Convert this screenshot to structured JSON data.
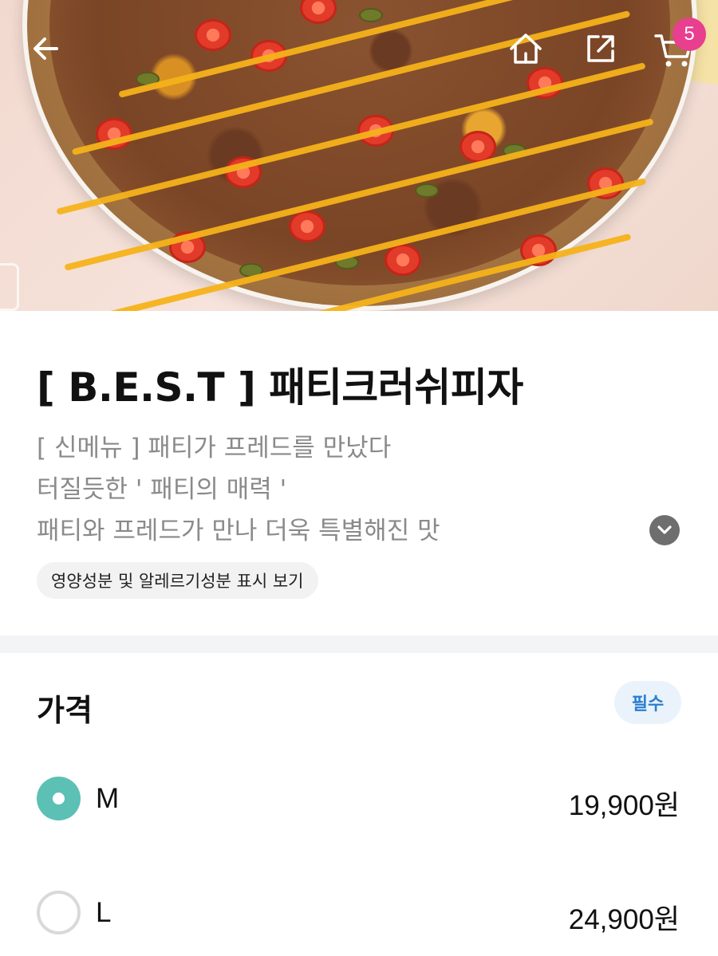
{
  "header": {
    "cart_count": "5",
    "icons": [
      "back-arrow-icon",
      "home-icon",
      "share-icon",
      "cart-icon"
    ]
  },
  "product": {
    "title": "[ B.E.S.T ] 패티크러쉬피자",
    "description": [
      "[ 신메뉴 ] 패티가 프레드를 만났다",
      "터질듯한 ' 패티의 매력 '",
      "패티와 프레드가 만나 더욱 특별해진 맛"
    ],
    "nutrition_link": "영양성분 및 알레르기성분 표시 보기"
  },
  "price_section": {
    "title": "가격",
    "required_label": "필수",
    "options": [
      {
        "label": "M",
        "price": "19,900원",
        "selected": true
      },
      {
        "label": "L",
        "price": "24,900원",
        "selected": false
      }
    ]
  },
  "colors": {
    "accent": "#5cc0b5",
    "badge": "#e83f8f",
    "required_text": "#2b7fcf"
  }
}
